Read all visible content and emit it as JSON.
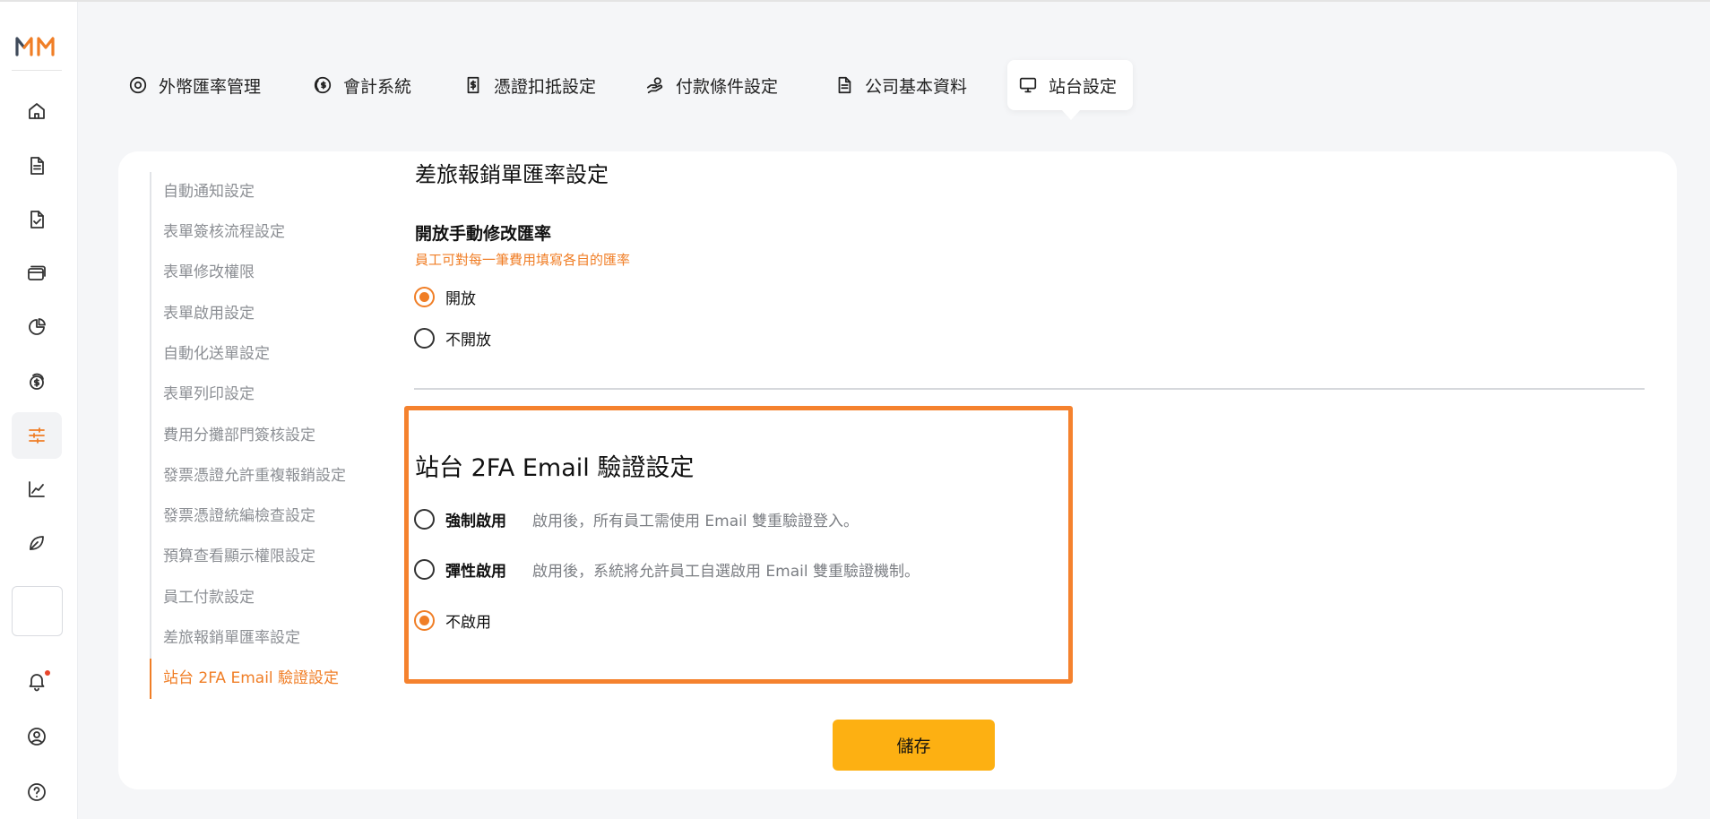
{
  "brand": {
    "logo_text": "MM",
    "accent": "#f07e26",
    "highlight": "#f5822e",
    "button": "#fdb012"
  },
  "sidebar": {
    "items": [
      {
        "icon": "home-icon"
      },
      {
        "icon": "document-icon"
      },
      {
        "icon": "document-check-icon"
      },
      {
        "icon": "card-icon"
      },
      {
        "icon": "pie-chart-icon"
      },
      {
        "icon": "dollar-stack-icon"
      },
      {
        "icon": "sliders-icon",
        "active": true
      },
      {
        "icon": "line-chart-icon"
      },
      {
        "icon": "leaf-icon"
      }
    ],
    "bottom": [
      {
        "icon": "bell-icon",
        "has_notification": true
      },
      {
        "icon": "user-circle-icon"
      },
      {
        "icon": "help-icon"
      }
    ]
  },
  "tabs": [
    {
      "label": "外幣匯率管理",
      "icon": "target-icon"
    },
    {
      "label": "會計系統",
      "icon": "coin-icon"
    },
    {
      "label": "憑證扣抵設定",
      "icon": "receipt-dollar-icon"
    },
    {
      "label": "付款條件設定",
      "icon": "hand-coin-icon"
    },
    {
      "label": "公司基本資料",
      "icon": "document-lines-icon"
    },
    {
      "label": "站台設定",
      "icon": "monitor-icon",
      "active": true
    }
  ],
  "subnav": {
    "items": [
      "自動通知設定",
      "表單簽核流程設定",
      "表單修改權限",
      "表單啟用設定",
      "自動化送單設定",
      "表單列印設定",
      "費用分攤部門簽核設定",
      "發票憑證允許重複報銷設定",
      "發票憑證統編檢查設定",
      "預算查看顯示權限設定",
      "員工付款設定",
      "差旅報銷單匯率設定",
      "站台 2FA Email 驗證設定"
    ],
    "active_index": 12
  },
  "exchange_section": {
    "title": "差旅報銷單匯率設定",
    "field_label": "開放手動修改匯率",
    "hint": "員工可對每一筆費用填寫各自的匯率",
    "options": [
      {
        "label": "開放",
        "checked": true
      },
      {
        "label": "不開放",
        "checked": false
      }
    ]
  },
  "twofa_section": {
    "title": "站台 2FA Email 驗證設定",
    "options": [
      {
        "label": "強制啟用",
        "desc": "啟用後，所有員工需使用 Email 雙重驗證登入。",
        "checked": false
      },
      {
        "label": "彈性啟用",
        "desc": "啟用後，系統將允許員工自選啟用 Email 雙重驗證機制。",
        "checked": false
      },
      {
        "label": "不啟用",
        "desc": "",
        "checked": true
      }
    ]
  },
  "save_label": "儲存"
}
